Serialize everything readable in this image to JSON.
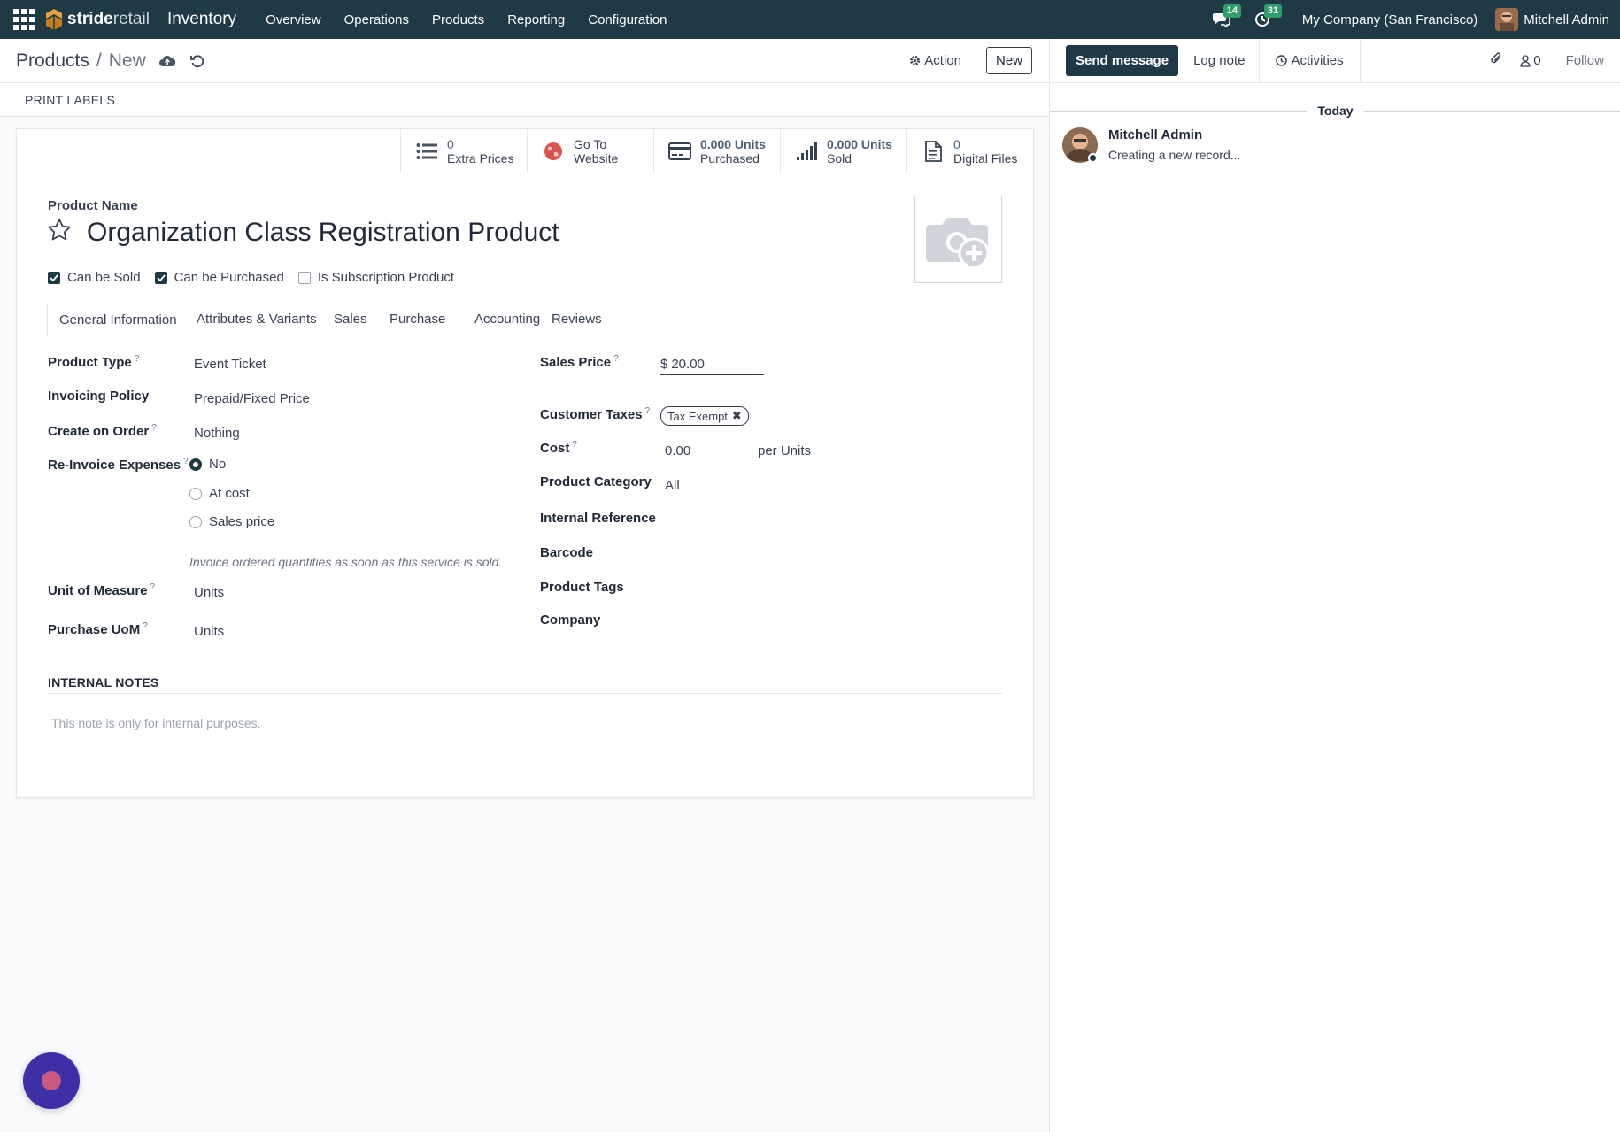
{
  "navbar": {
    "brand_bold": "stride",
    "brand_light": "retail",
    "app_name": "Inventory",
    "menu": [
      "Overview",
      "Operations",
      "Products",
      "Reporting",
      "Configuration"
    ],
    "messages_count": "14",
    "activities_count": "31",
    "company": "My Company (San Francisco)",
    "user": "Mitchell Admin"
  },
  "control": {
    "breadcrumb_parent": "Products",
    "breadcrumb_sep": "/",
    "breadcrumb_current": "New",
    "action_label": "Action",
    "new_label": "New"
  },
  "statusbar": {
    "print_labels": "PRINT LABELS"
  },
  "smart_buttons": [
    {
      "value": "0",
      "label": "Extra Prices",
      "icon": "list-icon"
    },
    {
      "value": "Go To",
      "label": "Website",
      "icon": "globe-icon"
    },
    {
      "value": "0.000 Units",
      "label": "Purchased",
      "icon": "credit-card-icon"
    },
    {
      "value": "0.000 Units",
      "label": "Sold",
      "icon": "signal-icon"
    },
    {
      "value": "0",
      "label": "Digital Files",
      "icon": "file-icon"
    }
  ],
  "product": {
    "name_label": "Product Name",
    "name": "Organization Class Registration Product",
    "can_be_sold": "Can be Sold",
    "can_be_purchased": "Can be Purchased",
    "is_subscription": "Is Subscription Product"
  },
  "tabs": [
    "General Information",
    "Attributes & Variants",
    "Sales",
    "Purchase",
    "Accounting",
    "Reviews"
  ],
  "general": {
    "product_type_label": "Product Type",
    "product_type": "Event Ticket",
    "invoicing_policy_label": "Invoicing Policy",
    "invoicing_policy": "Prepaid/Fixed Price",
    "create_on_order_label": "Create on Order",
    "create_on_order": "Nothing",
    "reinvoice_label": "Re-Invoice Expenses",
    "reinvoice_options": [
      "No",
      "At cost",
      "Sales price"
    ],
    "reinvoice_help": "Invoice ordered quantities as soon as this service is sold.",
    "uom_label": "Unit of Measure",
    "uom": "Units",
    "purchase_uom_label": "Purchase UoM",
    "purchase_uom": "Units",
    "sales_price_label": "Sales Price",
    "sales_price_currency": "$",
    "sales_price": "20.00",
    "customer_taxes_label": "Customer Taxes",
    "customer_tax_tag": "Tax Exempt",
    "cost_label": "Cost",
    "cost": "0.00",
    "cost_unit": "per Units",
    "product_category_label": "Product Category",
    "product_category": "All",
    "internal_reference_label": "Internal Reference",
    "barcode_label": "Barcode",
    "product_tags_label": "Product Tags",
    "company_label": "Company"
  },
  "notes": {
    "header": "INTERNAL NOTES",
    "placeholder": "This note is only for internal purposes."
  },
  "chatter": {
    "send_message": "Send message",
    "log_note": "Log note",
    "activities": "Activities",
    "followers_count": "0",
    "follow": "Follow",
    "today": "Today",
    "message_author": "Mitchell Admin",
    "message_body": "Creating a new record..."
  },
  "colors": {
    "navbar": "#1f3a44",
    "badge": "#2e9e6a",
    "primary": "#1f3a44",
    "fab": "#3d2fa5"
  }
}
